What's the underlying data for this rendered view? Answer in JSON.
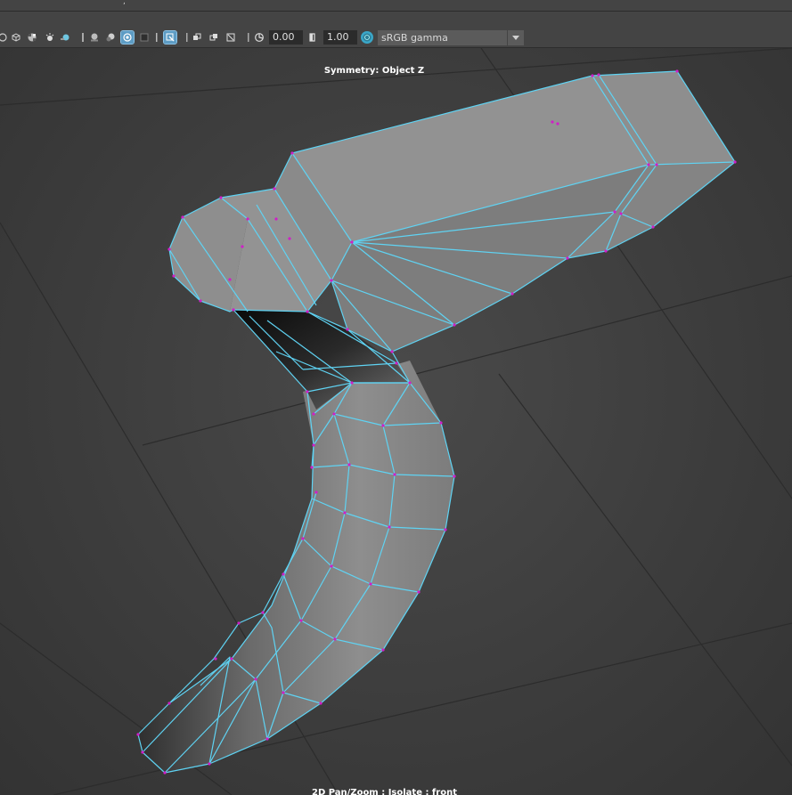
{
  "toolbar": {
    "exposure_value": "0.00",
    "gamma_value": "1.00",
    "color_management_label": "sRGB gamma",
    "icons": [
      "wireframe-on-shaded-icon",
      "xray-icon",
      "checker-icon",
      "lighting-icon",
      "shadows-icon",
      "ambient-occlusion-icon",
      "motion-blur-icon",
      "anti-aliasing-icon",
      "depth-of-field-icon",
      "isolate-select-icon",
      "xray-active-icon",
      "xray-joints-icon",
      "resolution-gate-icon",
      "exposure-icon",
      "gamma-icon",
      "color-management-icon"
    ]
  },
  "viewport": {
    "symmetry_label": "Symmetry: Object Z",
    "status_label": "2D Pan/Zoom : Isolate : front"
  },
  "colors": {
    "wire": "#5fd3f3",
    "vertex": "#d01ec8",
    "mesh_face": "#8c8c8c",
    "grid_line": "#2c2c2c"
  }
}
